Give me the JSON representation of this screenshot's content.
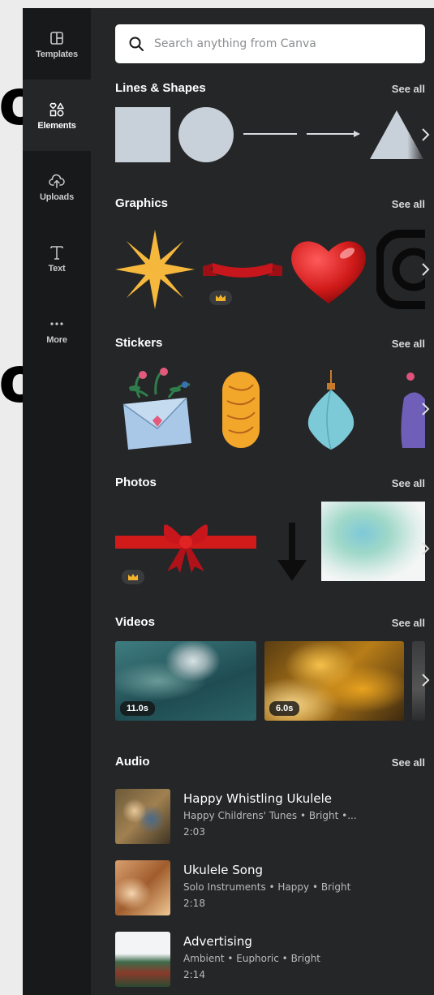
{
  "background": {
    "letters": [
      "o",
      "o"
    ]
  },
  "rail": {
    "items": [
      {
        "label": "Templates",
        "icon": "templates-icon"
      },
      {
        "label": "Elements",
        "icon": "elements-icon"
      },
      {
        "label": "Uploads",
        "icon": "upload-cloud-icon"
      },
      {
        "label": "Text",
        "icon": "text-icon"
      },
      {
        "label": "More",
        "icon": "more-dots-icon"
      }
    ],
    "active": "Elements"
  },
  "search": {
    "placeholder": "Search anything from Canva"
  },
  "sections": {
    "lines_shapes": {
      "title": "Lines & Shapes",
      "see_all": "See all"
    },
    "graphics": {
      "title": "Graphics",
      "see_all": "See all"
    },
    "stickers": {
      "title": "Stickers",
      "see_all": "See all"
    },
    "photos": {
      "title": "Photos",
      "see_all": "See all"
    },
    "videos": {
      "title": "Videos",
      "see_all": "See all",
      "durations": [
        "11.0s",
        "6.0s"
      ]
    },
    "audio": {
      "title": "Audio",
      "see_all": "See all"
    }
  },
  "audio_tracks": [
    {
      "title": "Happy Whistling Ukulele",
      "subtitle": "Happy Childrens' Tunes • Bright •...",
      "duration": "2:03"
    },
    {
      "title": "Ukulele Song",
      "subtitle": "Solo Instruments • Happy • Bright",
      "duration": "2:18"
    },
    {
      "title": "Advertising",
      "subtitle": "Ambient • Euphoric • Bright",
      "duration": "2:14"
    }
  ],
  "colors": {
    "panel_bg": "#252627",
    "rail_bg": "#18191b",
    "shape_fill": "#c8d0d9",
    "star": "#f5b83d",
    "heart": "#d11a1a",
    "ribbon": "#c8161d"
  }
}
